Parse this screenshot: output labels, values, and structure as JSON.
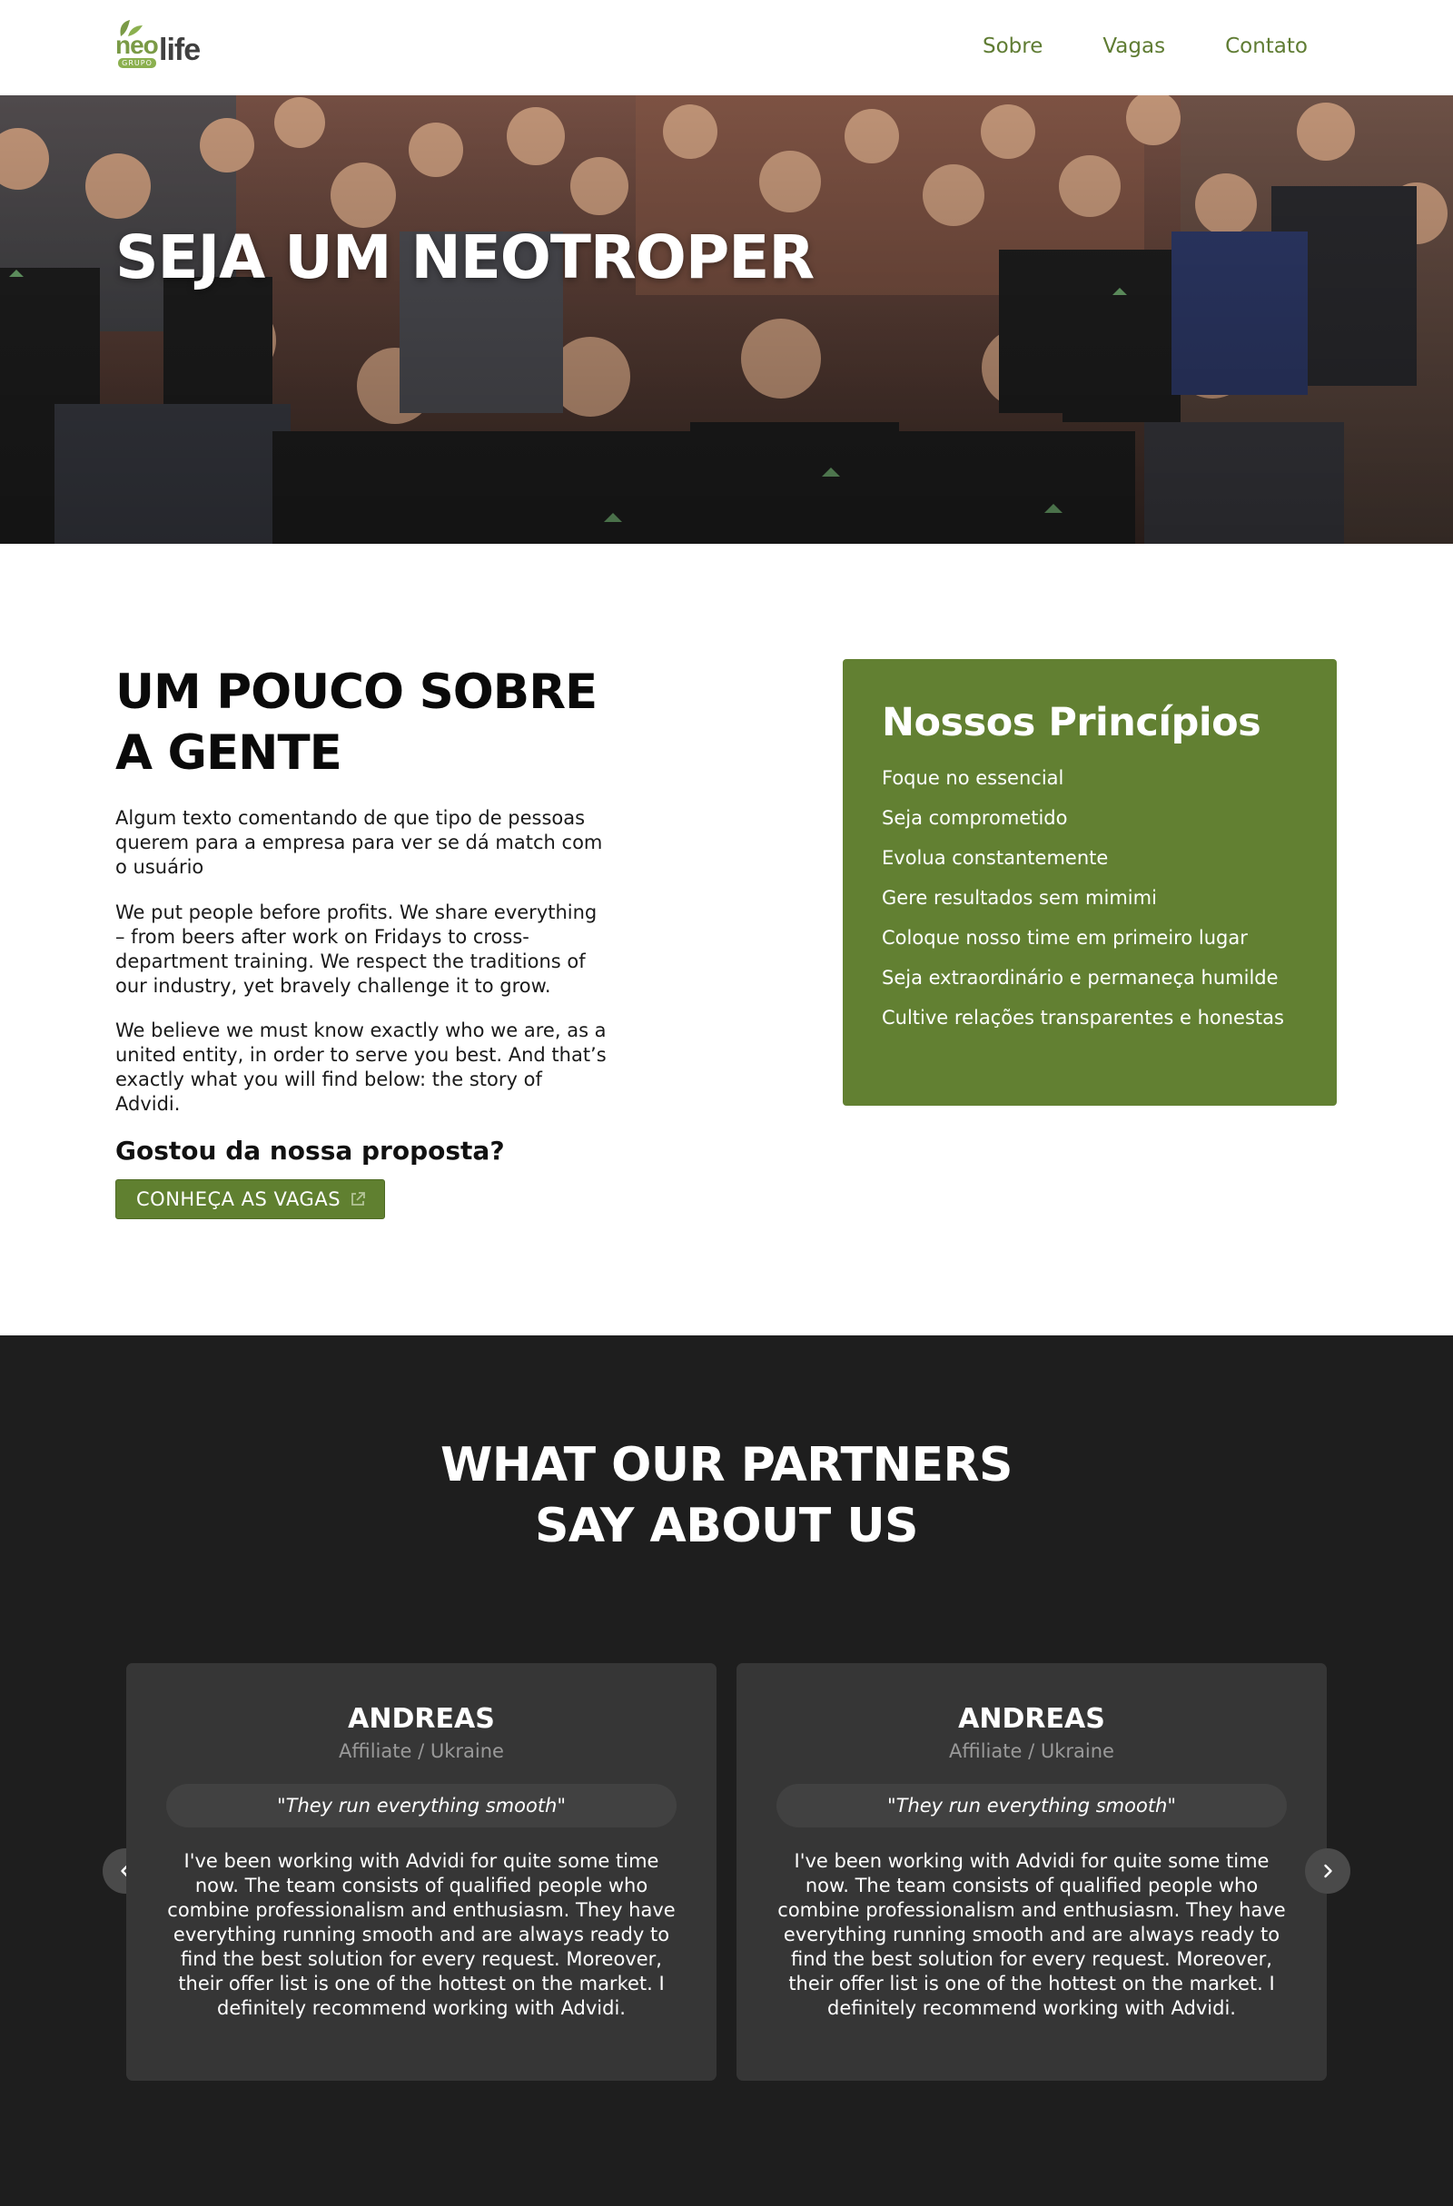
{
  "header": {
    "logo": {
      "neo": "neo",
      "life": "life",
      "grupo": "GRUPO"
    },
    "nav": [
      {
        "label": "Sobre"
      },
      {
        "label": "Vagas"
      },
      {
        "label": "Contato"
      }
    ]
  },
  "hero": {
    "title": "SEJA UM NEOTROPER",
    "image": "team-group-photo"
  },
  "about": {
    "title": "UM POUCO SOBRE A GENTE",
    "paragraphs": [
      "Algum texto comentando de que tipo de pessoas querem para a empresa para ver se dá match com o usuário",
      "We put people before profits. We share everything – from beers after work on Fridays to cross-department training. We respect the traditions of our industry, yet bravely challenge it to grow.",
      "We believe we must know exactly who we are, as a united entity, in order to serve you best. And that’s exactly what you will find below: the story of Advidi."
    ],
    "cta_title": "Gostou da nossa proposta?",
    "cta_button": "CONHEÇA AS VAGAS",
    "cta_icon": "external-link-icon"
  },
  "principles": {
    "title": "Nossos Princípios",
    "items": [
      "Foque no essencial",
      "Seja comprometido",
      "Evolua constantemente",
      "Gere resultados sem mimimi",
      "Coloque nosso time em primeiro lugar",
      "Seja extraordinário e permaneça humilde",
      "Cultive relações transparentes e honestas"
    ]
  },
  "testimonials": {
    "title_line1": "WHAT OUR PARTNERS",
    "title_line2": "SAY ABOUT US",
    "cards": [
      {
        "name": "ANDREAS",
        "role": "Affiliate / Ukraine",
        "quote": "\"They run everything smooth\"",
        "text": "I've been working with Advidi for quite some time now. The team consists of qualified people who combine professionalism and enthusiasm. They have everything running smooth and are always ready to find the best solution for every request. Moreover, their offer list is one of the hottest on the market. I definitely recommend working with Advidi."
      },
      {
        "name": "ANDREAS",
        "role": "Affiliate / Ukraine",
        "quote": "\"They run everything smooth\"",
        "text": "I've been working with Advidi for quite some time now. The team consists of qualified people who combine professionalism and enthusiasm. They have everything running smooth and are always ready to find the best solution for every request. Moreover, their offer list is one of the hottest on the market. I definitely recommend working with Advidi."
      }
    ],
    "prev_icon": "chevron-left-icon",
    "next_icon": "chevron-right-icon"
  },
  "colors": {
    "brand_green": "#628032",
    "nav_green": "#5f7c33",
    "dark_bg": "#1e1e1e",
    "card_bg": "#363636"
  }
}
